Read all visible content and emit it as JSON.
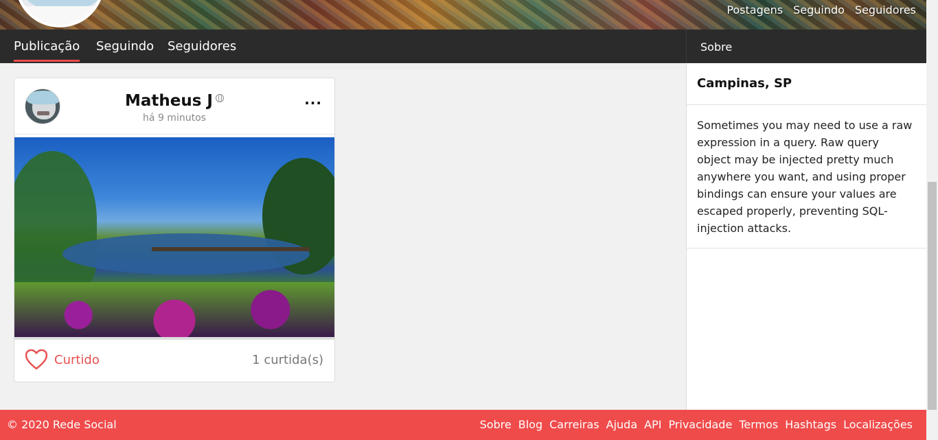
{
  "cover": {
    "nav": [
      "Postagens",
      "Seguindo",
      "Seguidores"
    ]
  },
  "tabs": {
    "items": [
      {
        "label": "Publicação",
        "active": true
      },
      {
        "label": "Seguindo"
      },
      {
        "label": "Seguidores"
      }
    ]
  },
  "post": {
    "author": "Matheus J",
    "time": "há 9 minutos",
    "more": "···",
    "like_label": "Curtido",
    "like_count": "1 curtida(s)"
  },
  "sidebar": {
    "header": "Sobre",
    "location": "Campinas, SP",
    "bio": "Sometimes you may need to use a raw expression in a query. Raw query object may be injected pretty much anywhere you want, and using proper bindings can ensure your values are escaped properly, preventing SQL-injection attacks."
  },
  "footer": {
    "copyright": "© 2020 Rede Social",
    "links": [
      "Sobre",
      "Blog",
      "Carreiras",
      "Ajuda",
      "API",
      "Privacidade",
      "Termos",
      "Hashtags",
      "Localizações"
    ]
  },
  "colors": {
    "accent": "#f04b4b",
    "dark_bar": "#2b2b2b",
    "heart": "#e85050"
  }
}
